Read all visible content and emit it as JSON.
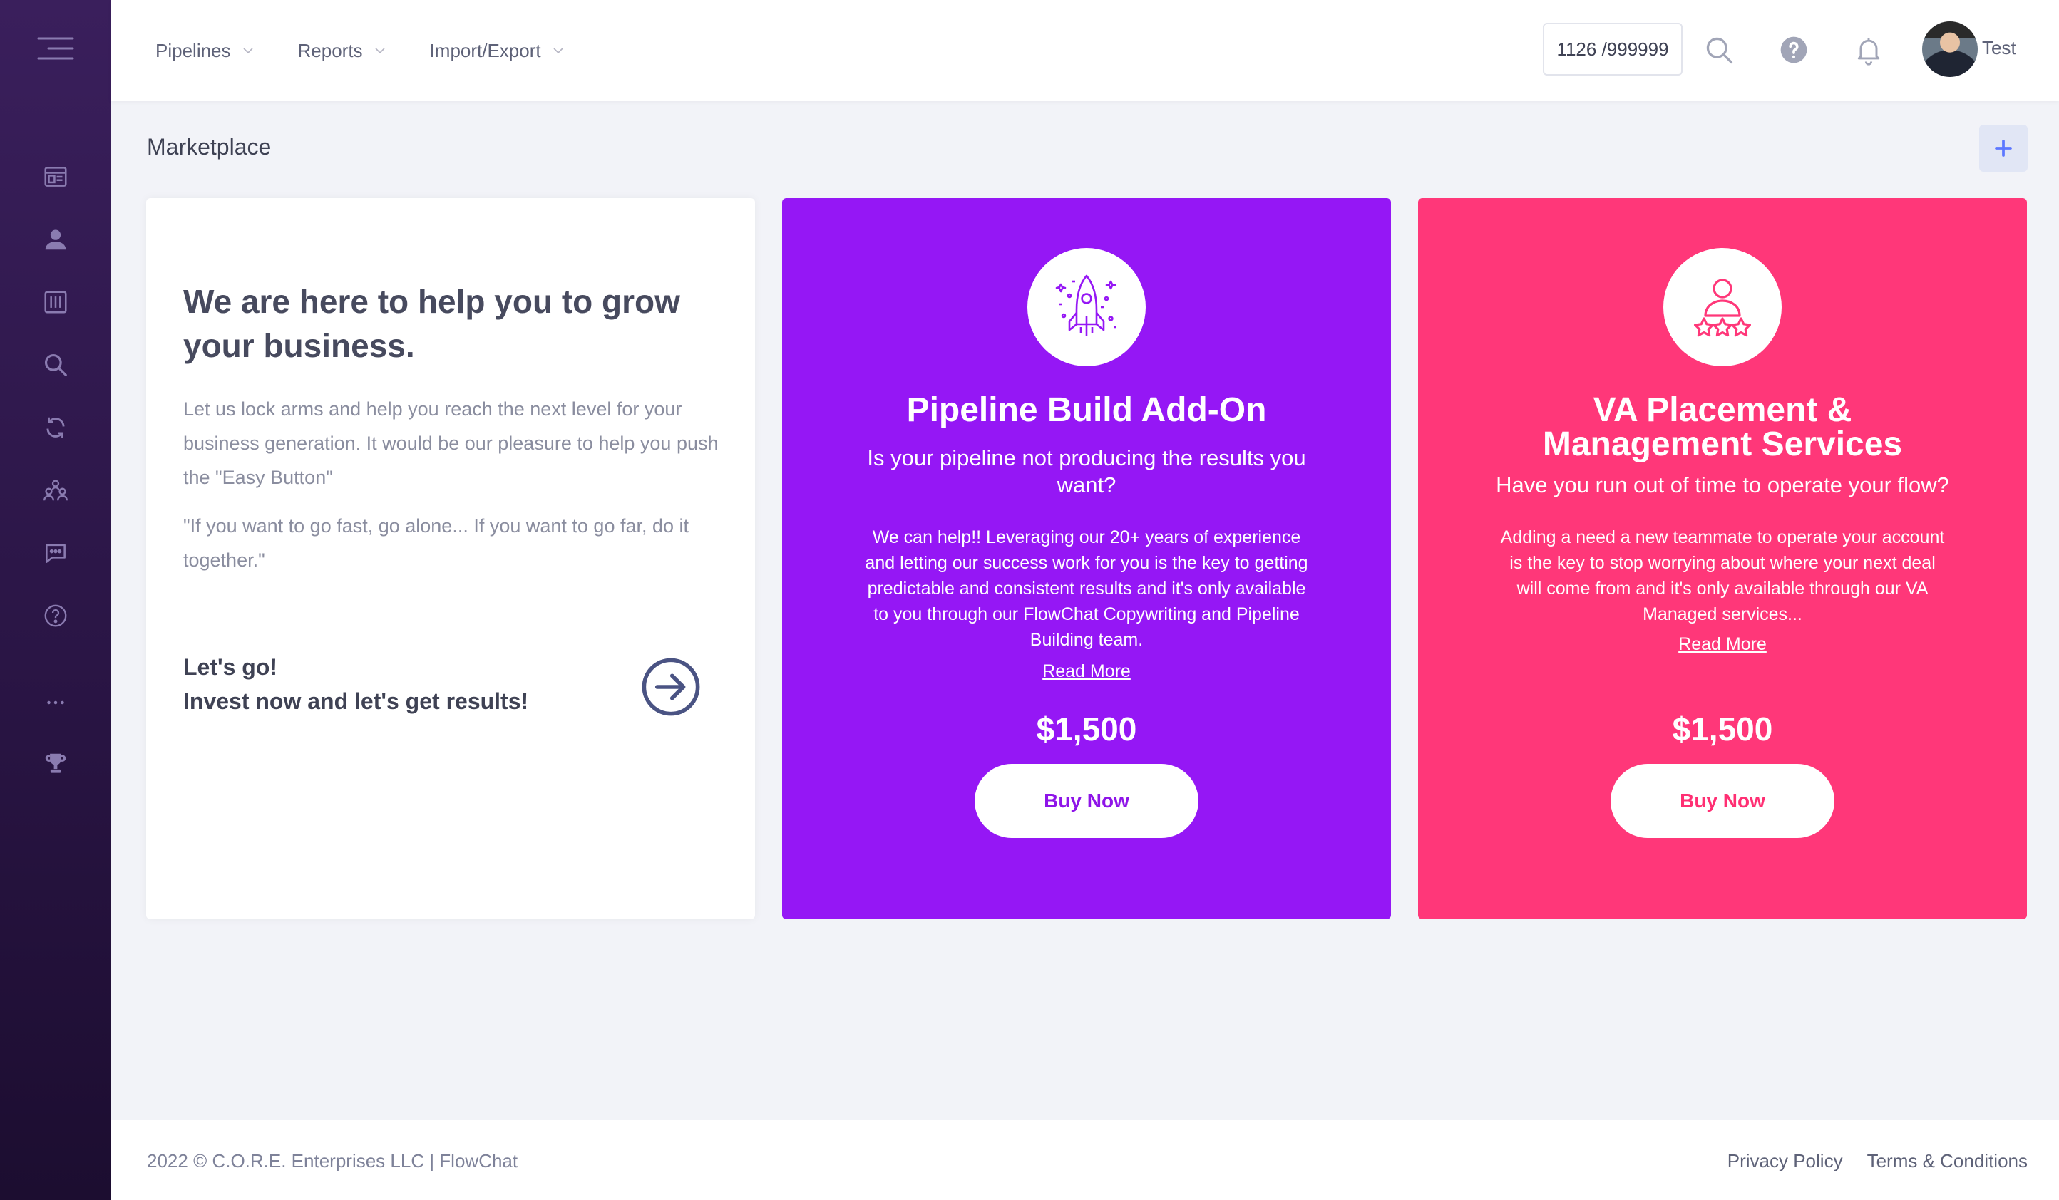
{
  "header": {
    "nav": [
      {
        "label": "Pipelines"
      },
      {
        "label": "Reports"
      },
      {
        "label": "Import/Export"
      }
    ],
    "counter": "1126 /999999",
    "username": "Test"
  },
  "sidebar": {
    "icons": [
      "menu-icon",
      "dashboard-icon",
      "contacts-icon",
      "reports-icon",
      "search-icon",
      "sync-icon",
      "team-icon",
      "chat-icon",
      "help-icon",
      "more-icon",
      "trophy-icon"
    ]
  },
  "page": {
    "title": "Marketplace"
  },
  "cards": {
    "intro": {
      "headline": "We are here to help you to grow your business.",
      "body1": "Let us lock arms and help you reach the next level for your business generation. It would be our pleasure to help you push the \"Easy Button\"",
      "body2": "\"If you want to go fast, go alone... If you want to go far, do it together.\"",
      "cta_line1": "Let's go!",
      "cta_line2": "Invest now and let's get results!"
    },
    "pipeline": {
      "title": "Pipeline Build Add-On",
      "subtitle": "Is your pipeline not producing the results you want?",
      "body": "We can help!! Leveraging our 20+ years of experience and letting our success work for you is the key to getting predictable and consistent results and it's only available to you through our FlowChat Copywriting and Pipeline Building team.",
      "read_more": "Read More",
      "price": "$1,500",
      "buy": "Buy Now"
    },
    "va": {
      "title": "VA Placement & Management Services",
      "subtitle": "Have you run out of time to operate your flow?",
      "body": "Adding a need a new teammate to operate your account is the key to stop worrying about where your next deal will come from and it's only available through our VA Managed services...",
      "read_more": "Read More",
      "price": "$1,500",
      "buy": "Buy Now"
    }
  },
  "footer": {
    "copyright": "2022 © C.O.R.E. Enterprises LLC | FlowChat",
    "privacy": "Privacy Policy",
    "terms": "Terms & Conditions"
  },
  "colors": {
    "sidebar": "#2a1545",
    "purple_card": "#9517f5",
    "pink_card": "#ff3779",
    "add_button_bg": "#e1e6f5",
    "accent_blue": "#5d78ff"
  }
}
